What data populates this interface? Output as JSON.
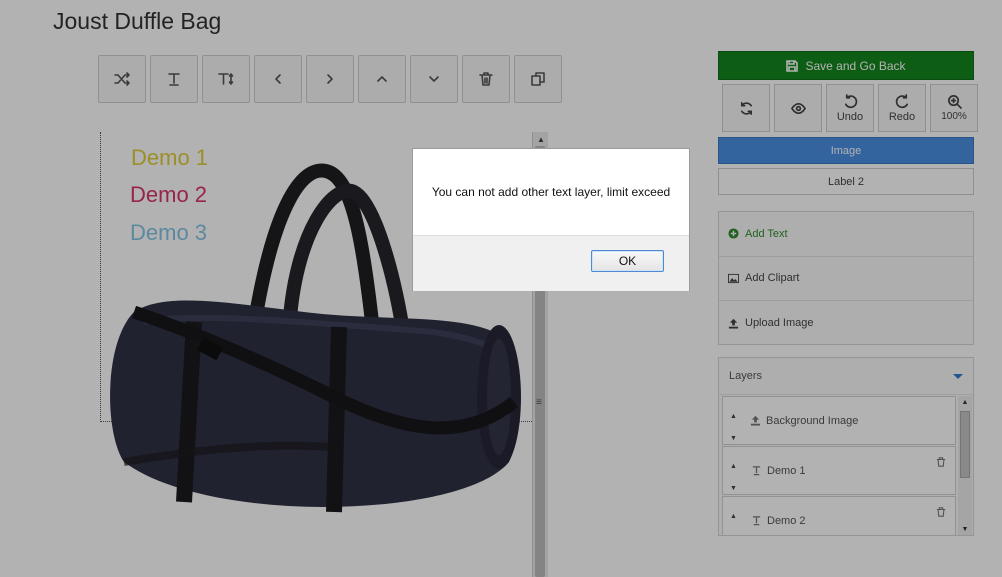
{
  "page": {
    "title": "Joust Duffle Bag"
  },
  "toolbar": {
    "buttons": [
      {
        "name": "shuffle-button",
        "icon": "shuffle-icon",
        "glyph": "⤨"
      },
      {
        "name": "text-button",
        "icon": "text-icon",
        "glyph": "T"
      },
      {
        "name": "text-size-button",
        "icon": "text-size-icon",
        "glyph": "Tꜝ"
      },
      {
        "name": "move-left-button",
        "icon": "chevron-left-icon",
        "glyph": "‹"
      },
      {
        "name": "move-right-button",
        "icon": "chevron-right-icon",
        "glyph": "›"
      },
      {
        "name": "move-up-button",
        "icon": "chevron-up-icon",
        "glyph": "˄"
      },
      {
        "name": "move-down-button",
        "icon": "chevron-down-icon",
        "glyph": "˅"
      },
      {
        "name": "delete-button",
        "icon": "trash-icon",
        "glyph": "🗑"
      },
      {
        "name": "duplicate-button",
        "icon": "copy-icon",
        "glyph": "⧉"
      }
    ]
  },
  "canvas": {
    "texts": [
      {
        "label": "Demo 1",
        "color": "#e0cd3a"
      },
      {
        "label": "Demo 2",
        "color": "#d8356c"
      },
      {
        "label": "Demo 3",
        "color": "#86c4e6"
      }
    ]
  },
  "right_panel": {
    "save_label": "Save and Go Back",
    "save_color": "#13871e",
    "tools": [
      {
        "name": "reset-button",
        "icon": "refresh-icon",
        "label": ""
      },
      {
        "name": "preview-button",
        "icon": "eye-icon",
        "label": ""
      },
      {
        "name": "undo-button",
        "icon": "undo-icon",
        "label": "Undo"
      },
      {
        "name": "redo-button",
        "icon": "redo-icon",
        "label": "Redo"
      },
      {
        "name": "zoom-button",
        "icon": "zoom-in-icon",
        "label": "100%"
      }
    ],
    "tabs": [
      {
        "label": "Image",
        "active": true
      },
      {
        "label": "Label 2",
        "active": false
      }
    ],
    "actions": [
      {
        "label": "Add Text",
        "icon": "plus-circle-icon"
      },
      {
        "label": "Add Clipart",
        "icon": "image-icon"
      },
      {
        "label": "Upload Image",
        "icon": "upload-icon"
      }
    ],
    "layers": {
      "title": "Layers",
      "items": [
        {
          "label": "Background Image",
          "icon": "upload-icon",
          "deletable": false
        },
        {
          "label": "Demo 1",
          "icon": "text-icon",
          "deletable": true
        },
        {
          "label": "Demo 2",
          "icon": "text-icon",
          "deletable": true
        }
      ]
    }
  },
  "dialog": {
    "message": "You can not add other text layer, limit exceed",
    "ok_label": "OK"
  }
}
